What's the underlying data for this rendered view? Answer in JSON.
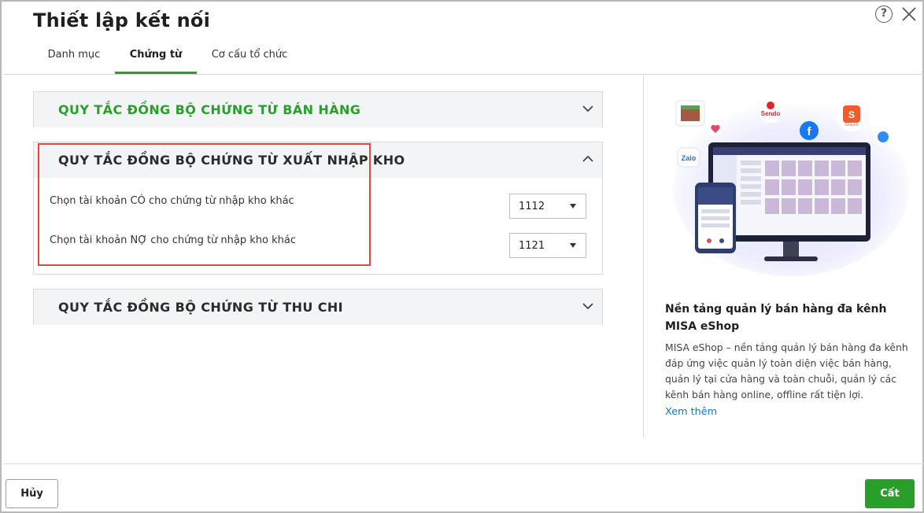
{
  "dialog": {
    "title": "Thiết lập kết nối",
    "help_label": "?"
  },
  "tabs": [
    {
      "label": "Danh mục",
      "active": false
    },
    {
      "label": "Chứng từ",
      "active": true
    },
    {
      "label": "Cơ cấu tổ chức",
      "active": false
    }
  ],
  "sections": [
    {
      "title": "QUY TẮC ĐỒNG BỘ CHỨNG TỪ BÁN HÀNG",
      "expanded": false
    },
    {
      "title": "QUY TẮC ĐỒNG BỘ CHỨNG TỪ XUẤT NHẬP KHO",
      "expanded": true,
      "fields": [
        {
          "label": "Chọn tài khoản CÓ cho chứng từ nhập kho khác",
          "value": "1112"
        },
        {
          "label": "Chọn tài khoản NỢ cho chứng từ nhập kho khác",
          "value": "1121"
        }
      ]
    },
    {
      "title": "QUY TẮC ĐỒNG BỘ CHỨNG TỪ THU CHI",
      "expanded": false
    }
  ],
  "promo": {
    "title": "Nền tảng quản lý bán hàng đa kênh MISA eShop",
    "description": "MISA eShop – nền tảng quản lý bán hàng đa kênh đáp ứng việc quản lý toàn diện việc bán hàng, quản lý tại cửa hàng và toàn chuỗi, quản lý các kênh bán hàng online, offline rất tiện lợi.",
    "link": "Xem thêm",
    "hero_labels": {
      "sendo": "Sendo",
      "zalo": "Zalo",
      "facebook": "f",
      "shopee": "S",
      "shopee_text": "Shopee"
    }
  },
  "footer": {
    "cancel_label": "Hủy",
    "save_label": "Cất"
  },
  "colors": {
    "accent": "#2a9e2a",
    "highlight": "#e04848",
    "link": "#1a73c8"
  }
}
